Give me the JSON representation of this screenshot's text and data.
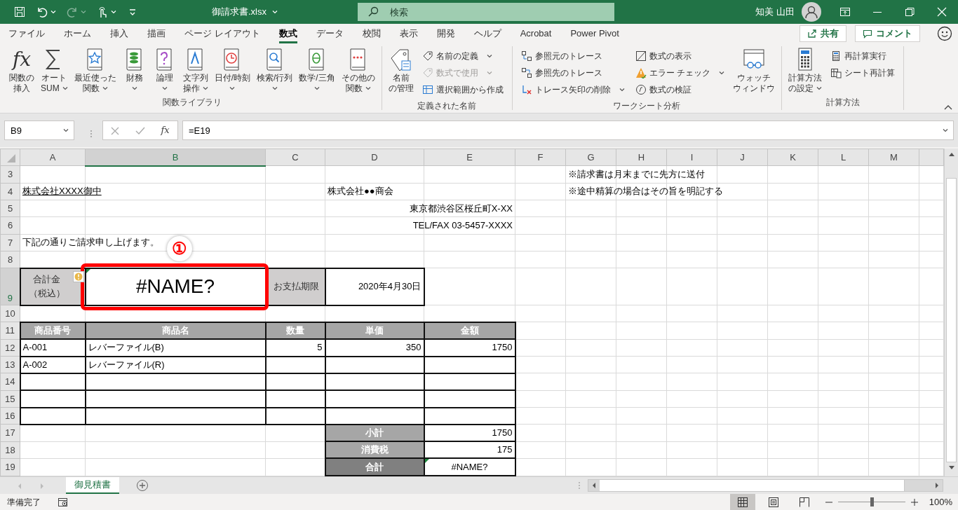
{
  "title_bar": {
    "quick_access": [
      {
        "dropdown": false,
        "disabled": false
      },
      {
        "dropdown": true,
        "disabled": false
      },
      {
        "dropdown": true,
        "disabled": true
      },
      {
        "dropdown": true,
        "disabled": false
      },
      {
        "dropdown": false,
        "disabled": false
      }
    ],
    "file_name": "御請求書.xlsx",
    "search": {
      "placeholder": "検索"
    },
    "user_name": "知美 山田"
  },
  "ribbon_tabs": [
    {
      "label": "ファイル",
      "selected": false
    },
    {
      "label": "ホーム",
      "selected": false
    },
    {
      "label": "挿入",
      "selected": false
    },
    {
      "label": "描画",
      "selected": false
    },
    {
      "label": "ページ レイアウト",
      "selected": false
    },
    {
      "label": "数式",
      "selected": true
    },
    {
      "label": "データ",
      "selected": false
    },
    {
      "label": "校閲",
      "selected": false
    },
    {
      "label": "表示",
      "selected": false
    },
    {
      "label": "開発",
      "selected": false
    },
    {
      "label": "ヘルプ",
      "selected": false
    },
    {
      "label": "Acrobat",
      "selected": false
    },
    {
      "label": "Power Pivot",
      "selected": false
    }
  ],
  "share_button": "共有",
  "comment_button": "コメント",
  "ribbon_groups": [
    {
      "label": "関数ライブラリ",
      "commands": [
        {
          "kind": "large",
          "glyph": "fx",
          "lines": [
            "関数の",
            "挿入"
          ],
          "dropdown": false,
          "disabled": false
        },
        {
          "kind": "large",
          "lines": [
            "オート",
            "SUM"
          ],
          "dropdown": true,
          "disabled": false
        },
        {
          "kind": "large",
          "lines": [
            "最近使った",
            "関数"
          ],
          "dropdown": true,
          "disabled": false
        },
        {
          "kind": "large",
          "lines": [
            "財務"
          ],
          "dropdown": true,
          "disabled": false
        },
        {
          "kind": "large",
          "lines": [
            "論理"
          ],
          "dropdown": true,
          "disabled": false
        },
        {
          "kind": "large",
          "lines": [
            "文字列",
            "操作"
          ],
          "dropdown": true,
          "disabled": false
        },
        {
          "kind": "large",
          "lines": [
            "日付/時刻"
          ],
          "dropdown": true,
          "disabled": false
        },
        {
          "kind": "large",
          "lines": [
            "検索/行列"
          ],
          "dropdown": true,
          "disabled": false
        },
        {
          "kind": "large",
          "lines": [
            "数学/三角"
          ],
          "dropdown": true,
          "disabled": false
        },
        {
          "kind": "large",
          "lines": [
            "その他の",
            "関数"
          ],
          "dropdown": true,
          "disabled": false
        }
      ]
    },
    {
      "label": "定義された名前",
      "commands": [
        {
          "kind": "large",
          "lines": [
            "名前",
            "の管理"
          ],
          "dropdown": false,
          "disabled": false
        },
        {
          "kind": "small",
          "lines": [
            "名前の定義"
          ],
          "dropdown": true,
          "disabled": false
        },
        {
          "kind": "small",
          "lines": [
            "数式で使用"
          ],
          "dropdown": true,
          "disabled": true
        },
        {
          "kind": "small",
          "lines": [
            "選択範囲から作成"
          ],
          "dropdown": false,
          "disabled": false
        }
      ]
    },
    {
      "label": "ワークシート分析",
      "commands": [
        {
          "kind": "small",
          "lines": [
            "参照元のトレース"
          ],
          "dropdown": false,
          "disabled": false
        },
        {
          "kind": "small",
          "lines": [
            "参照先のトレース"
          ],
          "dropdown": false,
          "disabled": false
        },
        {
          "kind": "small",
          "lines": [
            "トレース矢印の削除"
          ],
          "dropdown": true,
          "disabled": false
        },
        {
          "kind": "small",
          "lines": [
            "数式の表示"
          ],
          "dropdown": false,
          "disabled": false
        },
        {
          "kind": "small",
          "lines": [
            "エラー チェック"
          ],
          "dropdown": true,
          "disabled": false
        },
        {
          "kind": "small",
          "lines": [
            "数式の検証"
          ],
          "dropdown": false,
          "disabled": false
        },
        {
          "kind": "large",
          "lines": [
            "ウォッチ",
            "ウィンドウ"
          ],
          "dropdown": false,
          "disabled": false
        }
      ]
    },
    {
      "label": "計算方法",
      "commands": [
        {
          "kind": "large",
          "lines": [
            "計算方法",
            "の設定"
          ],
          "dropdown": true,
          "disabled": false
        },
        {
          "kind": "small",
          "lines": [
            "再計算実行"
          ],
          "dropdown": false,
          "disabled": false
        },
        {
          "kind": "small",
          "lines": [
            "シート再計算"
          ],
          "dropdown": false,
          "disabled": false
        }
      ]
    }
  ],
  "formula_bar": {
    "name_box": "B9",
    "function_glyph": "fx",
    "formula": "=E19"
  },
  "sheet": {
    "columns": [
      {
        "label": "A",
        "selected": false
      },
      {
        "label": "B",
        "selected": true
      },
      {
        "label": "C",
        "selected": false
      },
      {
        "label": "D",
        "selected": false
      },
      {
        "label": "E",
        "selected": false
      },
      {
        "label": "F",
        "selected": false
      },
      {
        "label": "G",
        "selected": false
      },
      {
        "label": "H",
        "selected": false
      },
      {
        "label": "I",
        "selected": false
      },
      {
        "label": "J",
        "selected": false
      },
      {
        "label": "K",
        "selected": false
      },
      {
        "label": "L",
        "selected": false
      },
      {
        "label": "M",
        "selected": false
      }
    ],
    "rows": [
      {
        "number": "3",
        "selected": false,
        "cells": [
          null,
          null,
          null,
          null,
          null,
          null,
          {
            "kind": "text",
            "text": "※請求書は月末までに先方に送付"
          }
        ]
      },
      {
        "number": "4",
        "selected": false,
        "cells": [
          {
            "kind": "text",
            "text": "株式会社XXXX御中",
            "underline": true
          },
          null,
          null,
          {
            "kind": "text",
            "text": "株式会社●●商会"
          },
          null,
          null,
          {
            "kind": "text",
            "text": "※途中精算の場合はその旨を明記する"
          }
        ]
      },
      {
        "number": "5",
        "selected": false,
        "cells": [
          null,
          null,
          null,
          null,
          {
            "kind": "number",
            "text": "東京都渋谷区桜丘町X-XX"
          }
        ]
      },
      {
        "number": "6",
        "selected": false,
        "cells": [
          null,
          null,
          null,
          null,
          {
            "kind": "number",
            "text": "TEL/FAX 03-5457-XXXX"
          }
        ]
      },
      {
        "number": "7",
        "selected": false,
        "cells": [
          {
            "kind": "text",
            "text": "下記の通りご請求申し上げます。"
          }
        ]
      },
      {
        "number": "8",
        "selected": false
      },
      {
        "number": "9",
        "selected": true,
        "cells": [
          {
            "kind": "label",
            "lines": [
              "合計金",
              "（税込）"
            ],
            "bordered": true
          },
          {
            "kind": "big",
            "text": "#NAME?",
            "bordered": true,
            "error_flag": true,
            "smart_tag": true,
            "highlighted": true
          },
          {
            "kind": "label",
            "lines": [
              "お支払期限"
            ],
            "bordered": true
          },
          {
            "kind": "number",
            "text": "2020年4月30日",
            "bordered": true
          }
        ]
      },
      {
        "number": "10",
        "selected": false
      },
      {
        "number": "11",
        "selected": false,
        "cells": [
          {
            "kind": "header",
            "text": "商品番号",
            "bordered": true
          },
          {
            "kind": "header",
            "text": "商品名",
            "bordered": true
          },
          {
            "kind": "header",
            "text": "数量",
            "bordered": true
          },
          {
            "kind": "header",
            "text": "単価",
            "bordered": true
          },
          {
            "kind": "header",
            "text": "金額",
            "bordered": true
          }
        ]
      },
      {
        "number": "12",
        "selected": false,
        "cells": [
          {
            "kind": "text",
            "text": "A-001",
            "bordered": true
          },
          {
            "kind": "text",
            "text": "レバーファイル(B)",
            "bordered": true
          },
          {
            "kind": "number",
            "text": "5",
            "bordered": true
          },
          {
            "kind": "number",
            "text": "350",
            "bordered": true
          },
          {
            "kind": "number",
            "text": "1750",
            "bordered": true
          }
        ]
      },
      {
        "number": "13",
        "selected": false,
        "cells": [
          {
            "kind": "text",
            "text": "A-002",
            "bordered": true
          },
          {
            "kind": "text",
            "text": "レバーファイル(R)",
            "bordered": true
          },
          {
            "bordered": true
          },
          {
            "bordered": true
          },
          {
            "bordered": true
          }
        ]
      },
      {
        "number": "14",
        "selected": false,
        "cells": [
          {
            "bordered": true
          },
          {
            "bordered": true
          },
          {
            "bordered": true
          },
          {
            "bordered": true
          },
          {
            "bordered": true
          }
        ]
      },
      {
        "number": "15",
        "selected": false,
        "cells": [
          {
            "bordered": true
          },
          {
            "bordered": true
          },
          {
            "bordered": true
          },
          {
            "bordered": true
          },
          {
            "bordered": true
          }
        ]
      },
      {
        "number": "16",
        "selected": false,
        "cells": [
          {
            "bordered": true
          },
          {
            "bordered": true
          },
          {
            "bordered": true
          },
          {
            "bordered": true
          },
          {
            "bordered": true
          }
        ]
      },
      {
        "number": "17",
        "selected": false,
        "cells": [
          null,
          null,
          null,
          {
            "kind": "sum_label",
            "text": "小計",
            "bordered": true
          },
          {
            "kind": "number",
            "text": "1750",
            "bordered": true
          }
        ]
      },
      {
        "number": "18",
        "selected": false,
        "cells": [
          null,
          null,
          null,
          {
            "kind": "sum_label",
            "text": "消費税",
            "bordered": true
          },
          {
            "kind": "number",
            "text": "175",
            "bordered": true
          }
        ]
      },
      {
        "number": "19",
        "selected": false,
        "cells": [
          null,
          null,
          null,
          {
            "kind": "total_label",
            "text": "合計",
            "bordered": true
          },
          {
            "kind": "center",
            "text": "#NAME?",
            "bordered": true,
            "error_flag": true
          }
        ]
      }
    ]
  },
  "annotation": {
    "marker": "①"
  },
  "sheet_tabs": [
    {
      "label": "御見積書",
      "selected": true
    }
  ],
  "status_bar": {
    "status": "準備完了",
    "views": [
      {
        "selected": true
      },
      {
        "selected": false
      },
      {
        "selected": false
      }
    ],
    "zoom": {
      "level": 0.5,
      "reading": "100%"
    }
  }
}
